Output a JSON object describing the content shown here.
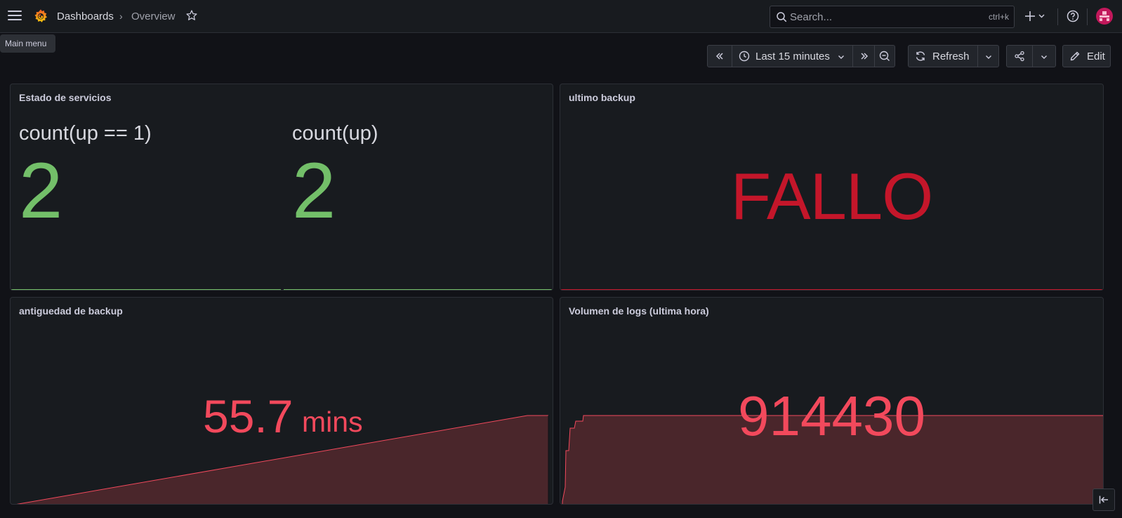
{
  "nav": {
    "breadcrumb_root": "Dashboards",
    "breadcrumb_sep": "›",
    "breadcrumb_current": "Overview",
    "search_placeholder": "Search...",
    "search_shortcut": "ctrl+k",
    "tooltip": "Main menu"
  },
  "toolbar": {
    "time_range": "Last 15 minutes",
    "refresh_label": "Refresh",
    "edit_label": "Edit"
  },
  "panels": {
    "estado": {
      "title": "Estado de servicios",
      "stats": [
        {
          "name": "count(up == 1)",
          "value": "2"
        },
        {
          "name": "count(up)",
          "value": "2"
        }
      ]
    },
    "backup": {
      "title": "ultimo backup",
      "value": "FALLO"
    },
    "antiguedad": {
      "title": "antiguedad de backup",
      "value": "55.7",
      "unit": "mins"
    },
    "volumen": {
      "title": "Volumen de logs (ultima hora)",
      "value": "914430"
    }
  },
  "colors": {
    "green": "#73bf69",
    "red_dark": "#c4162a",
    "red": "#f2495c",
    "bg": "#111217",
    "panel": "#181b1f"
  }
}
